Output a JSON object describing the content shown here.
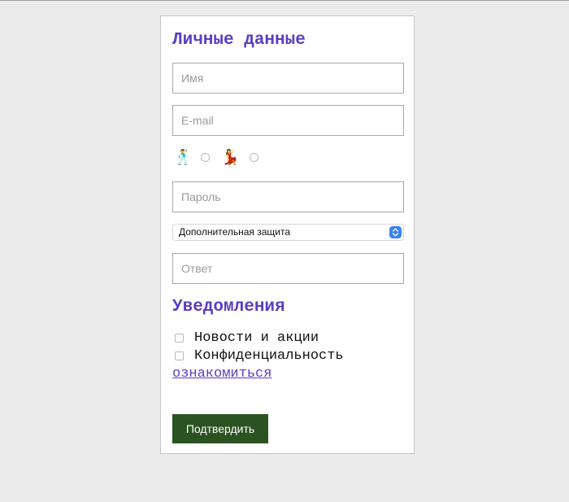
{
  "form": {
    "personal_title": "Личные данные",
    "name_placeholder": "Имя",
    "email_placeholder": "E-mail",
    "gender_options": [
      {
        "icon": "🕺",
        "icon_name": "dancing-man-icon"
      },
      {
        "icon": "💃",
        "icon_name": "dancing-woman-icon"
      }
    ],
    "password_placeholder": "Пароль",
    "security_select_value": "Дополнительная защита",
    "answer_placeholder": "Ответ",
    "notifications_title": "Уведомления",
    "checkboxes": [
      {
        "label": "Новости и акции",
        "checked": false
      },
      {
        "label": "Конфиденциальность",
        "checked": false
      }
    ],
    "privacy_link": "ознакомиться",
    "submit_label": "Подтвердить"
  },
  "colors": {
    "accent": "#5a3fc0",
    "submit_bg": "#2b5221",
    "page_bg": "#ececec"
  }
}
